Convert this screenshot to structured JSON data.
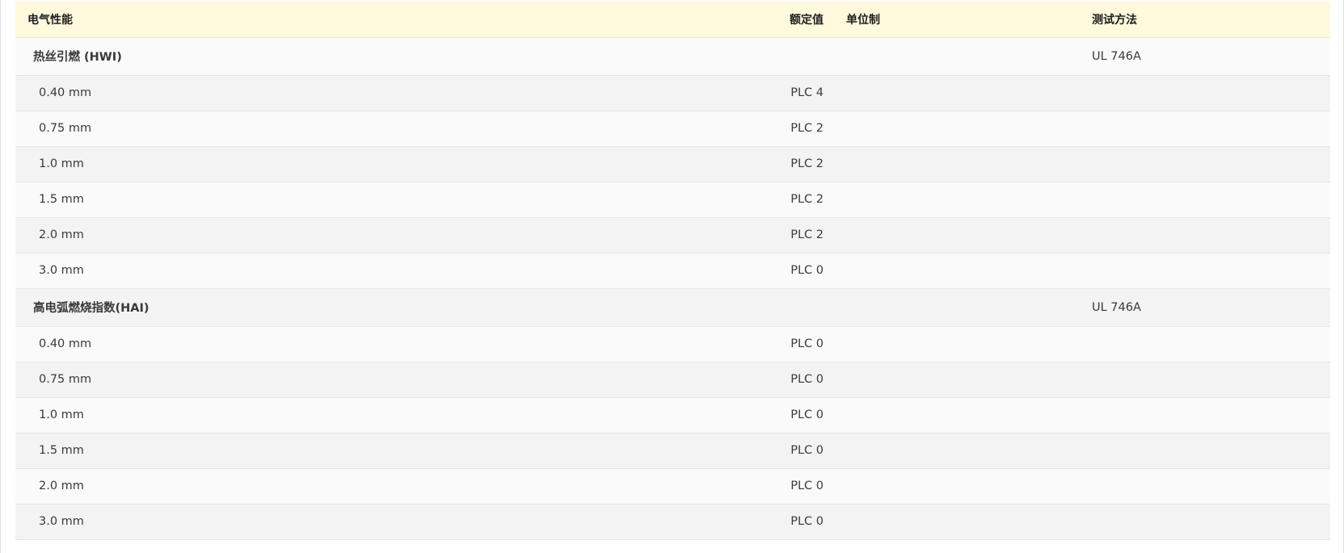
{
  "table": {
    "headers": {
      "property": "电气性能",
      "rated_value": "额定值",
      "unit": "单位制",
      "test_method": "测试方法"
    },
    "groups": [
      {
        "title": "热丝引燃 (HWI)",
        "test_method": "UL 746A",
        "rows": [
          {
            "thickness": "0.40 mm",
            "value": "PLC 4",
            "unit": ""
          },
          {
            "thickness": "0.75 mm",
            "value": "PLC 2",
            "unit": ""
          },
          {
            "thickness": "1.0 mm",
            "value": "PLC 2",
            "unit": ""
          },
          {
            "thickness": "1.5 mm",
            "value": "PLC 2",
            "unit": ""
          },
          {
            "thickness": "2.0 mm",
            "value": "PLC 2",
            "unit": ""
          },
          {
            "thickness": "3.0 mm",
            "value": "PLC 0",
            "unit": ""
          }
        ]
      },
      {
        "title": "高电弧燃烧指数(HAI)",
        "test_method": "UL 746A",
        "rows": [
          {
            "thickness": "0.40 mm",
            "value": "PLC 0",
            "unit": ""
          },
          {
            "thickness": "0.75 mm",
            "value": "PLC 0",
            "unit": ""
          },
          {
            "thickness": "1.0 mm",
            "value": "PLC 0",
            "unit": ""
          },
          {
            "thickness": "1.5 mm",
            "value": "PLC 0",
            "unit": ""
          },
          {
            "thickness": "2.0 mm",
            "value": "PLC 0",
            "unit": ""
          },
          {
            "thickness": "3.0 mm",
            "value": "PLC 0",
            "unit": ""
          }
        ]
      }
    ]
  }
}
